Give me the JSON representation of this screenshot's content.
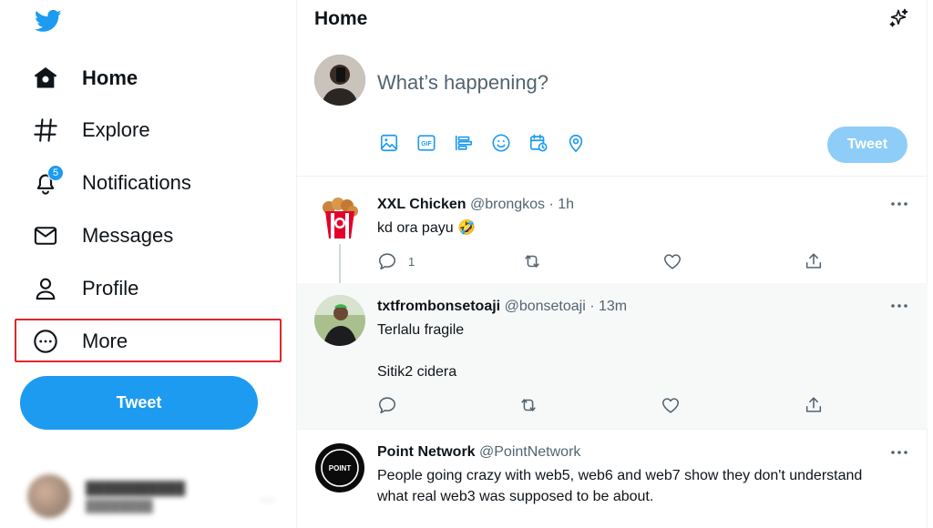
{
  "sidebar": {
    "logo": "twitter-bird-icon",
    "items": [
      {
        "label": "Home",
        "icon": "home-icon"
      },
      {
        "label": "Explore",
        "icon": "hashtag-icon"
      },
      {
        "label": "Notifications",
        "icon": "bell-icon",
        "badge": "5"
      },
      {
        "label": "Messages",
        "icon": "envelope-icon"
      },
      {
        "label": "Profile",
        "icon": "person-icon"
      },
      {
        "label": "More",
        "icon": "more-circle-icon"
      }
    ],
    "tweet_button": "Tweet"
  },
  "header": {
    "title": "Home",
    "sparkle_icon": "sparkle-icon"
  },
  "compose": {
    "placeholder": "What’s happening?",
    "tools": [
      "image-icon",
      "gif-icon",
      "poll-icon",
      "emoji-icon",
      "schedule-icon",
      "location-icon"
    ],
    "tweet_button": "Tweet"
  },
  "tweets": [
    {
      "name": "XXL Chicken",
      "handle": "@brongkos",
      "time": "1h",
      "text": "kd ora payu 🤣",
      "reply_count": "1"
    },
    {
      "name": "txtfrombonsetoaji",
      "handle": "@bonsetoaji",
      "time": "13m",
      "text": "Terlalu fragile\n\nSitik2 cidera",
      "reply_count": ""
    },
    {
      "name": "Point Network",
      "handle": "@PointNetwork",
      "text": "People going crazy with web5, web6 and web7 show they don't understand\nwhat real web3 was supposed to be about.",
      "avatar_label": "POINT"
    }
  ],
  "colors": {
    "accent": "#1d9bf0",
    "accent_disabled": "#8ecdf8",
    "highlight_box": "#e0262a",
    "secondary_text": "#536471"
  }
}
